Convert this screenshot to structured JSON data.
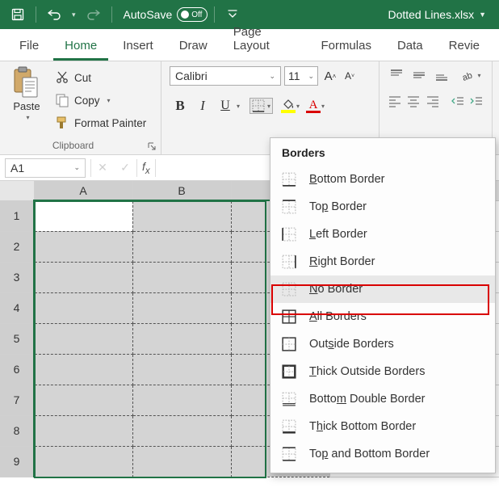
{
  "titlebar": {
    "autosave_label": "AutoSave",
    "autosave_state": "Off",
    "filename": "Dotted Lines.xlsx"
  },
  "tabs": {
    "file": "File",
    "home": "Home",
    "insert": "Insert",
    "draw": "Draw",
    "pagelayout": "Page Layout",
    "formulas": "Formulas",
    "data": "Data",
    "review": "Revie"
  },
  "ribbon": {
    "paste": "Paste",
    "cut": "Cut",
    "copy": "Copy",
    "format_painter": "Format Painter",
    "clipboard_group": "Clipboard",
    "font_name": "Calibri",
    "font_size": "11",
    "bold": "B",
    "italic": "I",
    "underline": "U",
    "fill_letter": "",
    "font_letter": "A"
  },
  "formula_bar": {
    "cell_ref": "A1",
    "formula": ""
  },
  "columns": [
    "A",
    "B",
    "",
    ""
  ],
  "rows": [
    "1",
    "2",
    "3",
    "4",
    "5",
    "6",
    "7",
    "8",
    "9"
  ],
  "borders_menu": {
    "title": "Borders",
    "items": [
      {
        "label_pre": "",
        "ul": "B",
        "label_post": "ottom Border"
      },
      {
        "label_pre": "To",
        "ul": "p",
        "label_post": " Border"
      },
      {
        "label_pre": "",
        "ul": "L",
        "label_post": "eft Border"
      },
      {
        "label_pre": "",
        "ul": "R",
        "label_post": "ight Border"
      },
      {
        "label_pre": "",
        "ul": "N",
        "label_post": "o Border"
      },
      {
        "label_pre": "",
        "ul": "A",
        "label_post": "ll Borders"
      },
      {
        "label_pre": "Out",
        "ul": "s",
        "label_post": "ide Borders"
      },
      {
        "label_pre": "",
        "ul": "T",
        "label_post": "hick Outside Borders"
      },
      {
        "label_pre": "Botto",
        "ul": "m",
        "label_post": " Double Border"
      },
      {
        "label_pre": "T",
        "ul": "h",
        "label_post": "ick Bottom Border"
      },
      {
        "label_pre": "To",
        "ul": "p",
        "label_post": " and Bottom Border"
      }
    ],
    "highlighted_index": 4
  }
}
